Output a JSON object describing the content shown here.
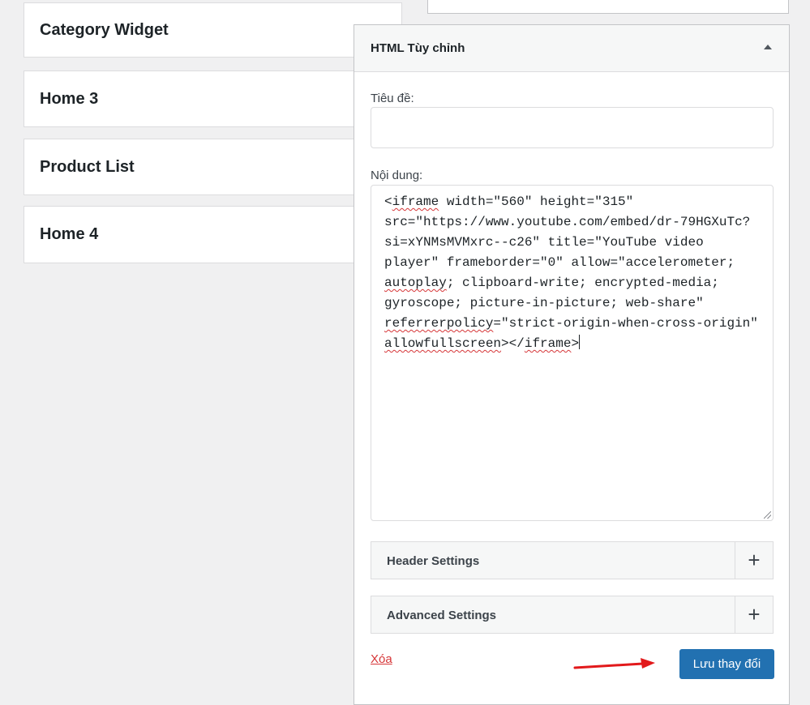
{
  "sidebar": {
    "items": [
      {
        "label": "Category Widget"
      },
      {
        "label": "Home 3"
      },
      {
        "label": "Product List"
      },
      {
        "label": "Home 4"
      }
    ]
  },
  "widget": {
    "title": "HTML Tùy chỉnh",
    "title_field_label": "Tiêu đề:",
    "title_value": "",
    "content_label": "Nội dung:",
    "content_value": "<iframe width=\"560\" height=\"315\" src=\"https://www.youtube.com/embed/dr-79HGXuTc?si=xYNMsMVMxrc--c26\" title=\"YouTube video player\" frameborder=\"0\" allow=\"accelerometer; autoplay; clipboard-write; encrypted-media; gyroscope; picture-in-picture; web-share\" referrerpolicy=\"strict-origin-when-cross-origin\" allowfullscreen></iframe>",
    "content_lines": [
      [
        "<",
        "~iframe",
        " width=\"560\" height=\"315\""
      ],
      [
        "src=\"https://www.youtube.com/embed/dr-79HGXuTc?"
      ],
      [
        "si=xYNMsMVMxrc--c26\" title=\"YouTube video"
      ],
      [
        "player\" frameborder=\"0\" allow=\"accelerometer;"
      ],
      [
        "~autoplay",
        "; clipboard-write; encrypted-media;"
      ],
      [
        "gyroscope; picture-in-picture; web-share\""
      ],
      [
        "~referrerpolicy",
        "=\"strict-origin-when-cross-origin\""
      ],
      [
        "~allowfullscreen",
        "></",
        "~iframe",
        ">|"
      ]
    ],
    "header_settings_label": "Header Settings",
    "advanced_settings_label": "Advanced Settings",
    "expand_symbol": "+",
    "delete_label": "Xóa",
    "save_label": "Lưu thay đổi"
  },
  "colors": {
    "accent": "#2271b1",
    "delete": "#d63638",
    "arrow": "#e2191b"
  }
}
